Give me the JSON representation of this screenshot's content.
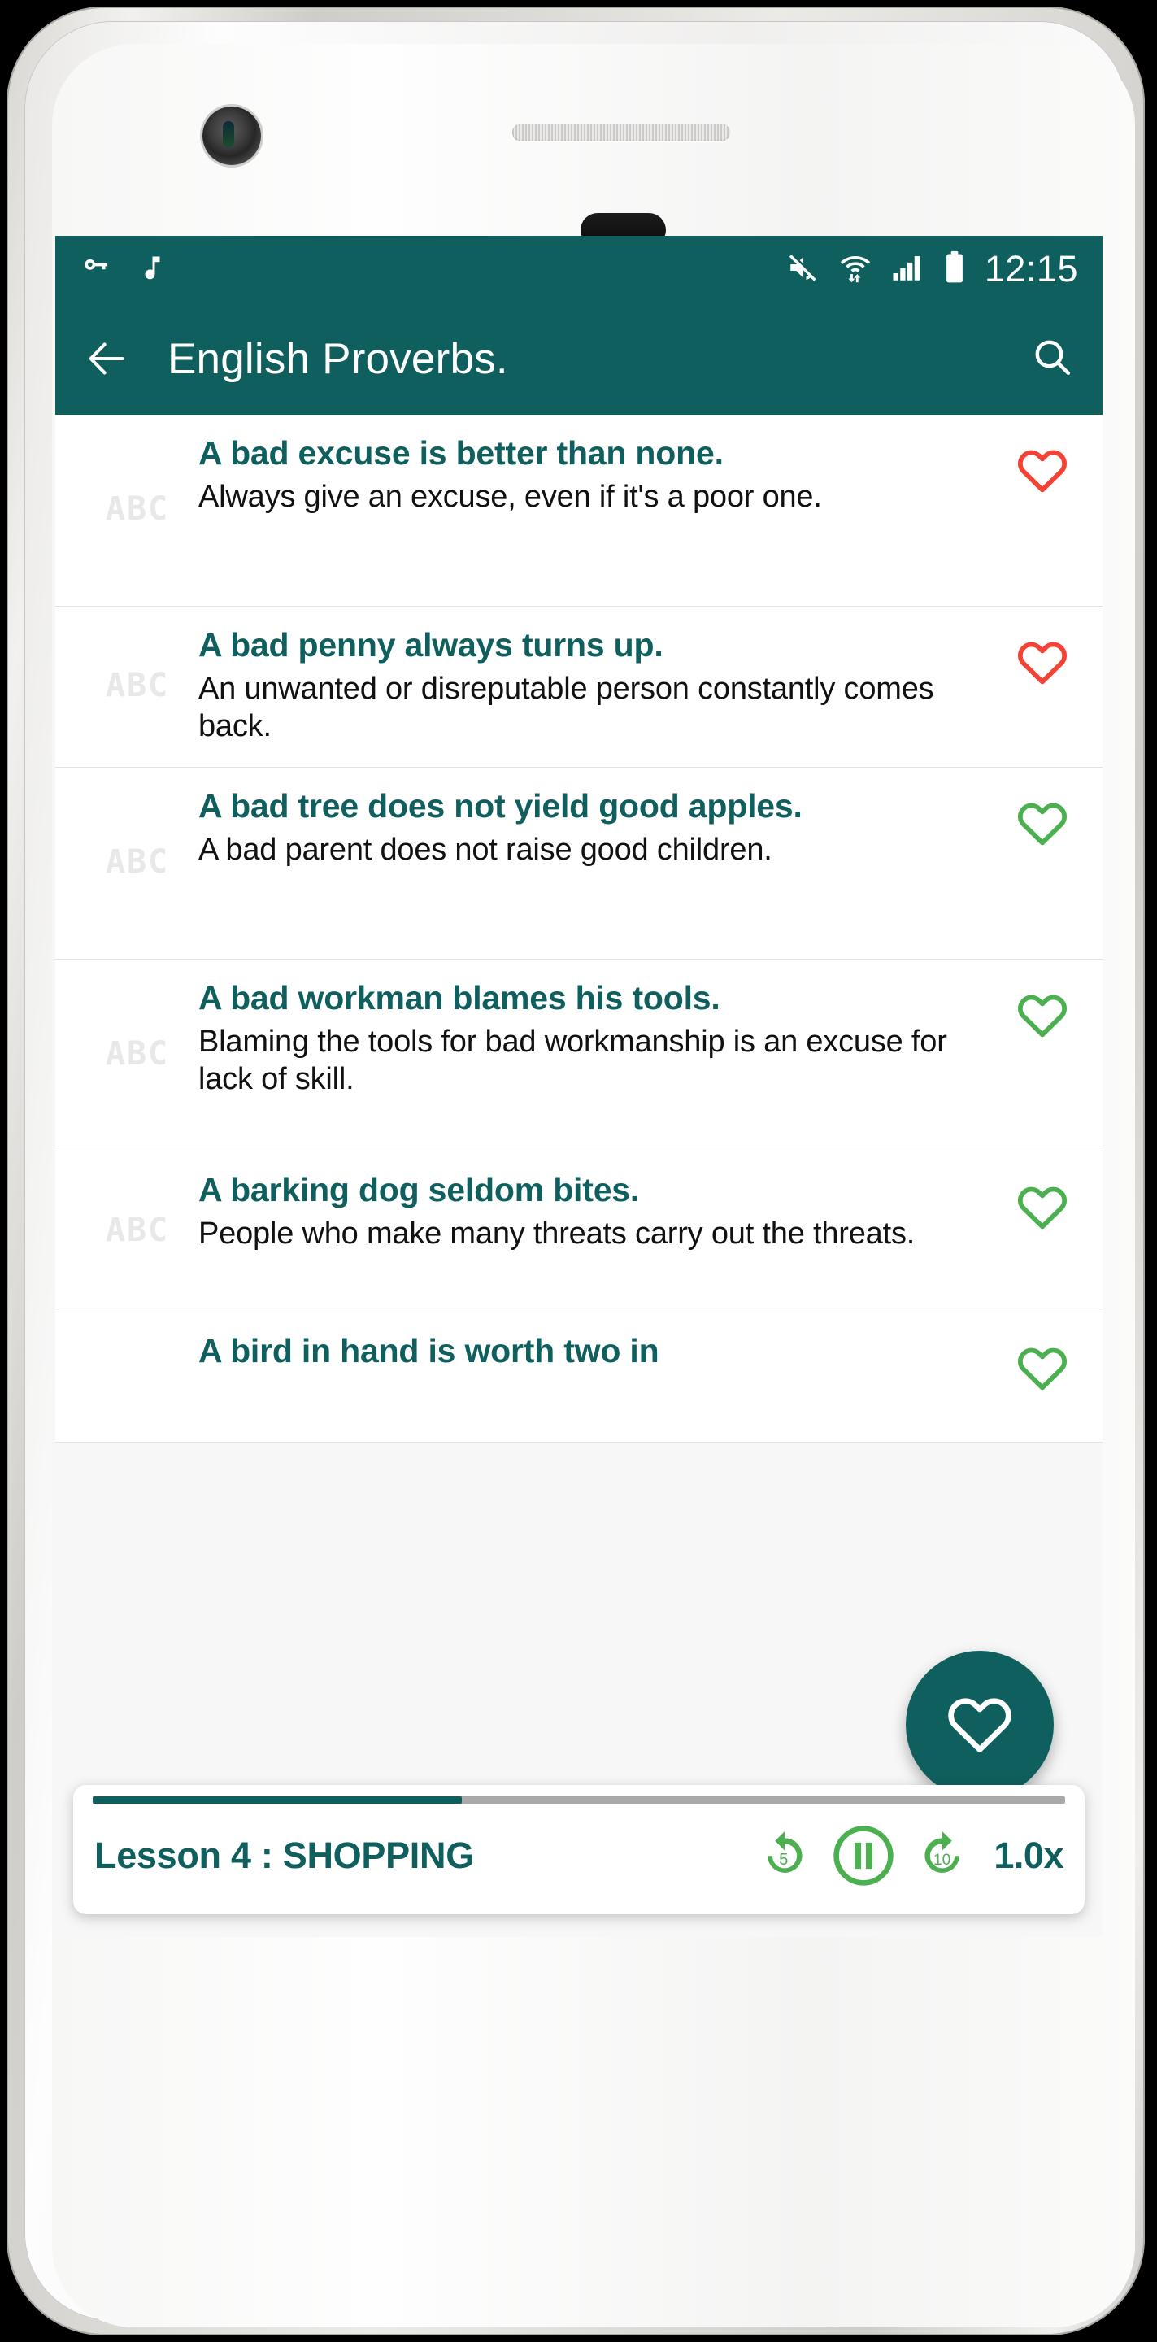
{
  "device": {
    "frame_name": "white-smartphone-mockup"
  },
  "status_bar": {
    "left_icons": [
      "key-icon",
      "music-note-icon"
    ],
    "right_icons": [
      "mute-icon",
      "wifi-icon",
      "signal-bars-icon",
      "battery-icon"
    ],
    "time": "12:15"
  },
  "app_bar": {
    "back_label": "back-arrow",
    "title": "English Proverbs.",
    "search_label": "search-icon",
    "bg_color": "#0f5f5e"
  },
  "colors": {
    "teal": "#0f5f5e",
    "green": "#4caf50",
    "red": "#f44336",
    "placeholder": "#e8e8e8"
  },
  "list": {
    "items": [
      {
        "thumb": "ABC",
        "title": "A bad excuse is better than none.",
        "description": "Always give an excuse, even if it's a poor one.",
        "favorite_color": "#f44336",
        "favorite_state": "unfilled-red"
      },
      {
        "thumb": "ABC",
        "title": "A bad penny always turns up.",
        "description": "An unwanted or disreputable person constantly comes back.",
        "favorite_color": "#f44336",
        "favorite_state": "unfilled-red"
      },
      {
        "thumb": "ABC",
        "title": "A bad tree does not yield good apples.",
        "description": "A bad parent does not raise good children.",
        "favorite_color": "#4caf50",
        "favorite_state": "unfilled-green"
      },
      {
        "thumb": "ABC",
        "title": "A bad workman blames his tools.",
        "description": "Blaming the tools for bad workmanship is an excuse for lack of skill.",
        "favorite_color": "#4caf50",
        "favorite_state": "unfilled-green"
      },
      {
        "thumb": "ABC",
        "title": "A barking dog seldom bites.",
        "description": "People who make many threats carry out the threats.",
        "favorite_color": "#4caf50",
        "favorite_state": "unfilled-green"
      },
      {
        "thumb": "",
        "title": "A bird in hand is worth two in",
        "description": "",
        "favorite_color": "#4caf50",
        "favorite_state": "unfilled-green"
      }
    ]
  },
  "fab": {
    "icon": "heart-outline-icon",
    "bg_color": "#0f5f5e"
  },
  "player": {
    "lesson_title": "Lesson 4 : SHOPPING",
    "rewind_label": "5",
    "forward_label": "10",
    "play_state": "pause-icon",
    "speed": "1.0x",
    "progress_percent": 38
  }
}
